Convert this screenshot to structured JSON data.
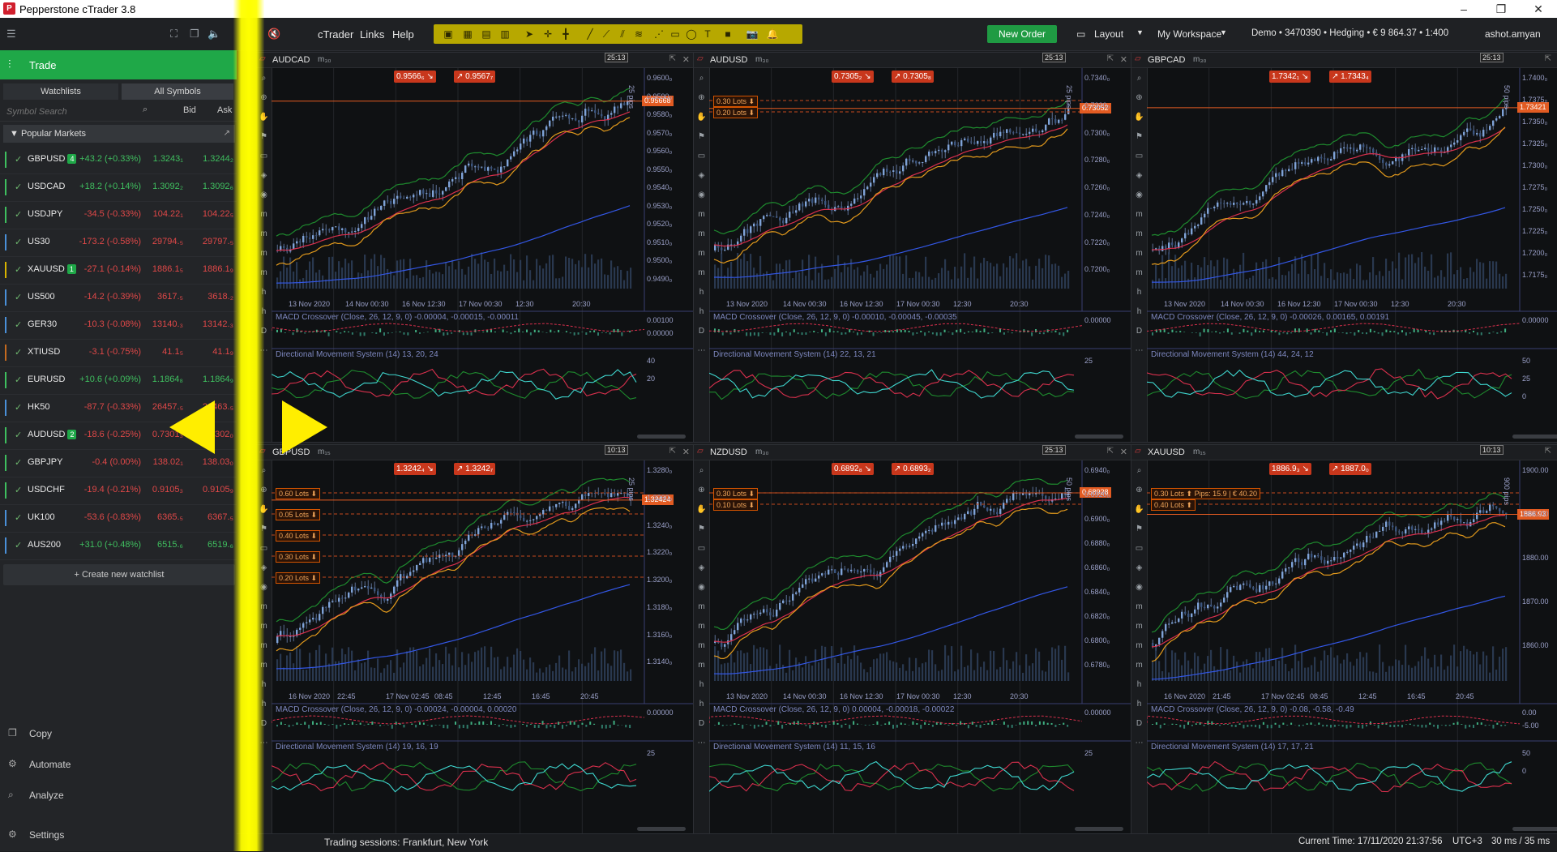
{
  "window": {
    "title": "Pepperstone cTrader 3.8",
    "logo": "P",
    "min": "–",
    "max": "❐",
    "close": "✕"
  },
  "menu": {
    "ctrader": "cTrader",
    "links": "Links",
    "help": "Help"
  },
  "toolbar": {
    "new_order": "New Order",
    "layout": "Layout",
    "workspace": "My Workspace",
    "account": "Demo • 3470390 • Hedging • € 9 864.37 • 1:400",
    "user": "ashot.amyan"
  },
  "sidebar": {
    "trade": "Trade",
    "tabs": [
      "Watchlists",
      "All Symbols"
    ],
    "search_placeholder": "Symbol Search",
    "bid_header": "Bid",
    "ask_header": "Ask",
    "section": "▼  Popular Markets",
    "rows": [
      {
        "sym": "GBPUSD",
        "badge": "4",
        "chg": "+43.2 (+0.33%)",
        "bid": "1.3243₁",
        "ask": "1.3244₂",
        "bar": "#3fbf5f",
        "pos": true
      },
      {
        "sym": "USDCAD",
        "badge": "",
        "chg": "+18.2 (+0.14%)",
        "bid": "1.3092₂",
        "ask": "1.3092₆",
        "bar": "#3fbf5f",
        "pos": true
      },
      {
        "sym": "USDJPY",
        "badge": "",
        "chg": "-34.5 (-0.33%)",
        "bid": "104.22₁",
        "ask": "104.22₅",
        "bar": "#3fbf5f",
        "pos": false
      },
      {
        "sym": "US30",
        "badge": "",
        "chg": "-173.2 (-0.58%)",
        "bid": "29794.₅",
        "ask": "29797.₅",
        "bar": "#4a90d9",
        "pos": false
      },
      {
        "sym": "XAUUSD",
        "badge": "1",
        "chg": "-27.1 (-0.14%)",
        "bid": "1886.1₅",
        "ask": "1886.1₉",
        "bar": "#d9b400",
        "pos": false
      },
      {
        "sym": "US500",
        "badge": "",
        "chg": "-14.2 (-0.39%)",
        "bid": "3617.₅",
        "ask": "3618.₂",
        "bar": "#4a90d9",
        "pos": false
      },
      {
        "sym": "GER30",
        "badge": "",
        "chg": "-10.3 (-0.08%)",
        "bid": "13140.₃",
        "ask": "13142.₃",
        "bar": "#4a90d9",
        "pos": false
      },
      {
        "sym": "XTIUSD",
        "badge": "",
        "chg": "-3.1 (-0.75%)",
        "bid": "41.1₅",
        "ask": "41.1₉",
        "bar": "#c56a1f",
        "pos": false
      },
      {
        "sym": "EURUSD",
        "badge": "",
        "chg": "+10.6 (+0.09%)",
        "bid": "1.1864₈",
        "ask": "1.1864₉",
        "bar": "#3fbf5f",
        "pos": true
      },
      {
        "sym": "HK50",
        "badge": "",
        "chg": "-87.7 (-0.33%)",
        "bid": "26457.₅",
        "ask": "26463.₅",
        "bar": "#4a90d9",
        "pos": false
      },
      {
        "sym": "AUDUSD",
        "badge": "2",
        "chg": "-18.6 (-0.25%)",
        "bid": "0.7301₃",
        "ask": "0.7302₀",
        "bar": "#3fbf5f",
        "pos": false
      },
      {
        "sym": "GBPJPY",
        "badge": "",
        "chg": "-0.4 (0.00%)",
        "bid": "138.02₁",
        "ask": "138.03₀",
        "bar": "#3fbf5f",
        "pos": false
      },
      {
        "sym": "USDCHF",
        "badge": "",
        "chg": "-19.4 (-0.21%)",
        "bid": "0.9105₃",
        "ask": "0.9105₉",
        "bar": "#3fbf5f",
        "pos": false
      },
      {
        "sym": "UK100",
        "badge": "",
        "chg": "-53.6 (-0.83%)",
        "bid": "6365.₅",
        "ask": "6367.₅",
        "bar": "#4a90d9",
        "pos": false
      },
      {
        "sym": "AUS200",
        "badge": "",
        "chg": "+31.0 (+0.48%)",
        "bid": "6515.₆",
        "ask": "6519.₆",
        "bar": "#4a90d9",
        "pos": true
      }
    ],
    "create_watchlist": "+ Create new watchlist",
    "bottom": [
      "Copy",
      "Automate",
      "Analyze",
      "Settings"
    ]
  },
  "charts": [
    {
      "id": "audcad",
      "sym": "AUDCAD",
      "tf": "m₃₀",
      "sell": "0.9566₆",
      "buy": "0.9567₇",
      "cur": "0.95668",
      "timer": "25:13",
      "axis": [
        "0.9600₀",
        "0.9590₀",
        "0.9580₀",
        "0.9570₀",
        "0.9560₀",
        "0.9550₀",
        "0.9540₀",
        "0.9530₀",
        "0.9520₀",
        "0.9510₀",
        "0.9500₀",
        "0.9490₀"
      ],
      "times": [
        "13 Nov 2020",
        "14 Nov 00:30",
        "16 Nov 12:30",
        "17 Nov 00:30",
        "12:30",
        "20:30"
      ],
      "pips": "25 pips",
      "macd": "MACD Crossover (Close, 26, 12, 9, 0) -0.00004, -0.00015, -0.00011",
      "macd_axis": [
        "0.00100",
        "0.00000"
      ],
      "dms": "Directional Movement System (14) 13, 20, 24",
      "dms_axis": [
        "40",
        "20"
      ],
      "lots": []
    },
    {
      "id": "audusd",
      "sym": "AUDUSD",
      "tf": "m₃₀",
      "sell": "0.7305₂",
      "buy": "0.7305₈",
      "cur": "0.73052",
      "timer": "25:13",
      "axis": [
        "0.7340₀",
        "0.7320₀",
        "0.7300₀",
        "0.7280₀",
        "0.7260₀",
        "0.7240₀",
        "0.7220₀",
        "0.7200₀"
      ],
      "times": [
        "13 Nov 2020",
        "14 Nov 00:30",
        "16 Nov 12:30",
        "17 Nov 00:30",
        "12:30",
        "20:30"
      ],
      "pips": "25 pips",
      "macd": "MACD Crossover (Close, 26, 12, 9, 0) -0.00010, -0.00045, -0.00035",
      "macd_axis": [
        "0.00000"
      ],
      "dms": "Directional Movement System (14) 22, 13, 21",
      "dms_axis": [
        "25"
      ],
      "lots": [
        "0.30 Lots ⬇",
        "0.20 Lots ⬇"
      ]
    },
    {
      "id": "gbpcad",
      "sym": "GBPCAD",
      "tf": "m₃₀",
      "sell": "1.7342₁",
      "buy": "1.7343₄",
      "cur": "1.73421",
      "timer": "25:13",
      "axis": [
        "1.7400₀",
        "1.7375₀",
        "1.7350₀",
        "1.7325₀",
        "1.7300₀",
        "1.7275₀",
        "1.7250₀",
        "1.7225₀",
        "1.7200₀",
        "1.7175₀"
      ],
      "times": [
        "13 Nov 2020",
        "14 Nov 00:30",
        "16 Nov 12:30",
        "17 Nov 00:30",
        "12:30",
        "20:30"
      ],
      "pips": "50 pips",
      "macd": "MACD Crossover (Close, 26, 12, 9, 0) -0.00026, 0.00165, 0.00191",
      "macd_axis": [
        "0.00000"
      ],
      "dms": "Directional Movement System (14) 44, 24, 12",
      "dms_axis": [
        "50",
        "25",
        "0"
      ],
      "lots": []
    },
    {
      "id": "gbpusd",
      "sym": "GBPUSD",
      "tf": "m₁₅",
      "sell": "1.3242₄",
      "buy": "1.3242₇",
      "cur": "1.32424",
      "timer": "10:13",
      "axis": [
        "1.3280₀",
        "1.3260₀",
        "1.3240₀",
        "1.3220₀",
        "1.3200₀",
        "1.3180₀",
        "1.3160₀",
        "1.3140₀"
      ],
      "times": [
        "16 Nov 2020",
        "22:45",
        "17 Nov 02:45",
        "08:45",
        "12:45",
        "16:45",
        "20:45"
      ],
      "pips": "25 pips",
      "macd": "MACD Crossover (Close, 26, 12, 9, 0) -0.00024, -0.00004, 0.00020",
      "macd_axis": [
        "0.00000"
      ],
      "dms": "Directional Movement System (14) 19, 16, 19",
      "dms_axis": [
        "25"
      ],
      "lots": [
        "0.60 Lots ⬇",
        "0.05 Lots ⬇",
        "0.40 Lots ⬇",
        "0.30 Lots ⬇",
        "0.20 Lots ⬇"
      ]
    },
    {
      "id": "nzdusd",
      "sym": "NZDUSD",
      "tf": "m₃₀",
      "sell": "0.6892₈",
      "buy": "0.6893₂",
      "cur": "0.68928",
      "timer": "25:13",
      "axis": [
        "0.6940₀",
        "0.6920₀",
        "0.6900₀",
        "0.6880₀",
        "0.6860₀",
        "0.6840₀",
        "0.6820₀",
        "0.6800₀",
        "0.6780₀"
      ],
      "times": [
        "13 Nov 2020",
        "14 Nov 00:30",
        "16 Nov 12:30",
        "17 Nov 00:30",
        "12:30",
        "20:30"
      ],
      "pips": "50 pips",
      "macd": "MACD Crossover (Close, 26, 12, 9, 0) 0.00004, -0.00018, -0.00022",
      "macd_axis": [
        "0.00000"
      ],
      "dms": "Directional Movement System (14) 11, 15, 16",
      "dms_axis": [
        "25"
      ],
      "lots": [
        "0.30 Lots ⬇",
        "0.10 Lots ⬇"
      ]
    },
    {
      "id": "xauusd",
      "sym": "XAUUSD",
      "tf": "m₁₅",
      "sell": "1886.9₃",
      "buy": "1887.0₀",
      "cur": "1886.93",
      "timer": "10:13",
      "axis": [
        "1900.00",
        "1890.00",
        "1880.00",
        "1870.00",
        "1860.00"
      ],
      "times": [
        "16 Nov 2020",
        "21:45",
        "17 Nov 02:45",
        "08:45",
        "12:45",
        "16:45",
        "20:45"
      ],
      "pips": "900 pips",
      "macd": "MACD Crossover (Close, 26, 12, 9, 0) -0.08, -0.58, -0.49",
      "macd_axis": [
        "0.00",
        "-5.00"
      ],
      "dms": "Directional Movement System (14) 17, 17, 21",
      "dms_axis": [
        "50",
        "0"
      ],
      "lots": [
        "0.30 Lots ⬆  Pips: 15.9 | € 40.20",
        "0.40 Lots ⬆"
      ]
    }
  ],
  "status": {
    "sessions": "Trading sessions: Frankfurt, New York",
    "time": "Current Time: 17/11/2020 21:37:56",
    "tz": "UTC+3",
    "latency": "30 ms / 35 ms"
  },
  "colors": {
    "accent": "#1fa848",
    "sell": "#c8371c",
    "buy": "#1f9b43",
    "highlight": "#ffee00"
  }
}
